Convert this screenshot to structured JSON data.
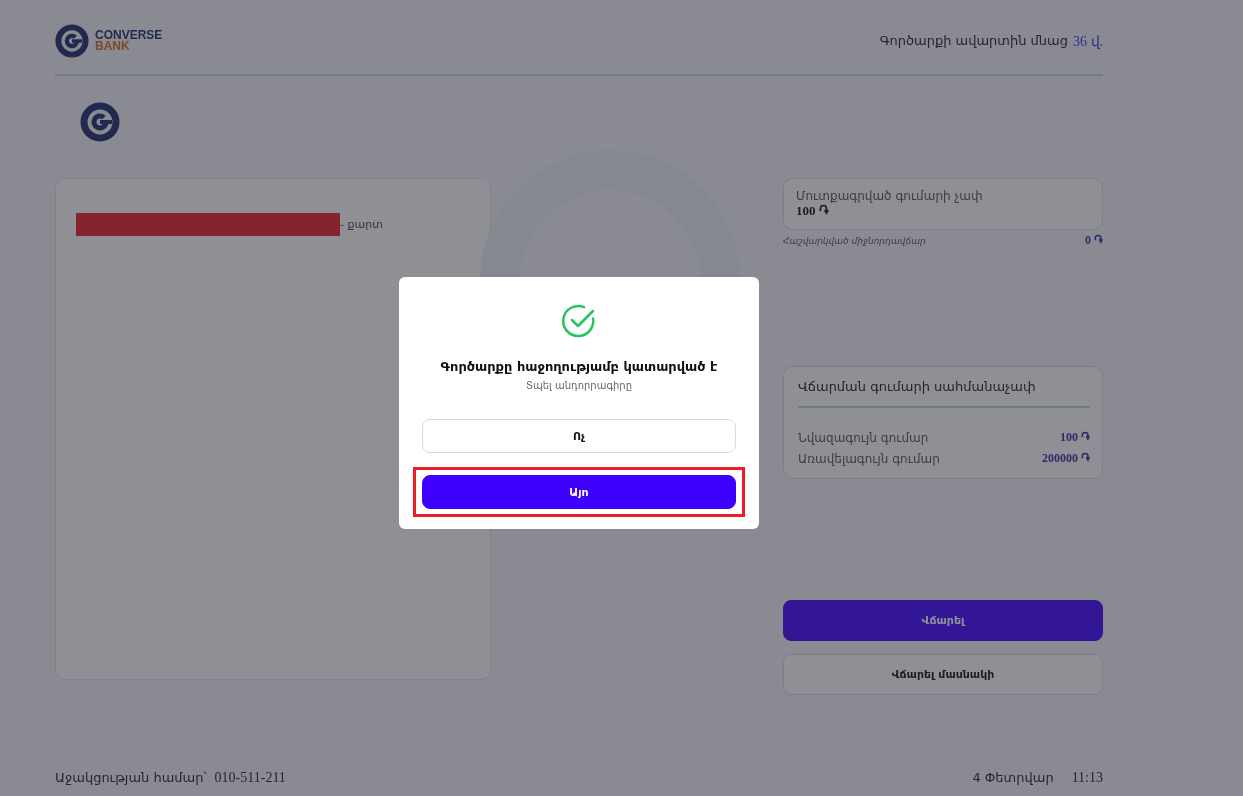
{
  "header": {
    "logo_word": "CONVERSE",
    "logo_subword": "BANK",
    "timer_label": "Գործարքի ավարտին մնաց",
    "timer_value": "36 վ."
  },
  "card": {
    "text": "- քարտ",
    "redacted": true
  },
  "entered_amount": {
    "label": "Մուտքագրված գումարի չափ",
    "value": "100 ֏"
  },
  "commission": {
    "label": "Հաշվարկված միջնորդավճար",
    "value": "0 ֏"
  },
  "limits": {
    "title": "Վճարման գումարի սահմանաչափ",
    "rows": [
      {
        "label": "Նվազագույն գումար",
        "value": "100 ֏"
      },
      {
        "label": "Առավելագույն գումար",
        "value": "200000 ֏"
      }
    ]
  },
  "actions": [
    {
      "label": "Վճարել",
      "kind": "primary"
    },
    {
      "label": "Վճարել մասնակի",
      "kind": "secondary"
    }
  ],
  "footer": {
    "support_label": "Աջակցության համար՝",
    "support_phone": "010-511-211",
    "date": "4 Փետրվար",
    "time": "11:13"
  },
  "dialog": {
    "title": "Գործարքը հաջողությամբ կատարված է",
    "subtitle": "Տպել անդորրագիրը",
    "buttons": [
      {
        "label": "Ոչ",
        "kind": "secondary",
        "highlighted": false
      },
      {
        "label": "Այո",
        "kind": "primary",
        "highlighted": true
      }
    ]
  }
}
